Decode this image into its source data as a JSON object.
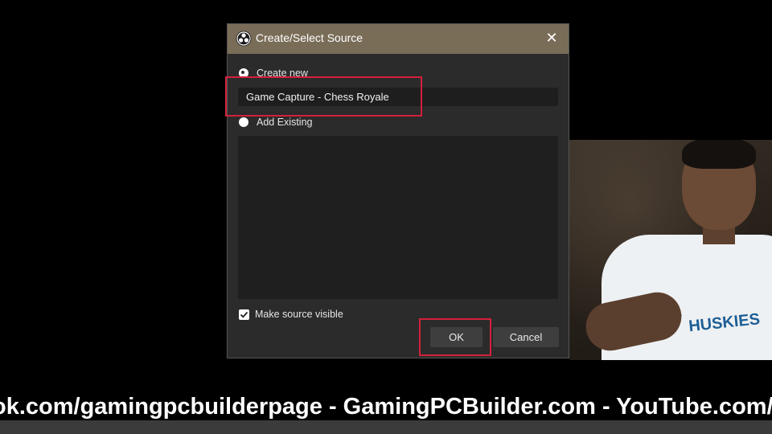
{
  "dialog": {
    "title": "Create/Select Source",
    "create_new_label": "Create new",
    "name_value": "Game Capture - Chess Royale",
    "add_existing_label": "Add Existing",
    "make_visible_label": "Make source visible",
    "make_visible_checked": true,
    "ok_label": "OK",
    "cancel_label": "Cancel"
  },
  "webcam": {
    "shirt_text": "HUSKIES"
  },
  "ticker": {
    "text": "ok.com/gamingpcbuilderpage - GamingPCBuilder.com - YouTube.com/c/ga"
  },
  "colors": {
    "titlebar": "#7a6d58",
    "highlight": "#d3203a",
    "dialog_bg": "#2b2b2b"
  },
  "icons": {
    "app": "obs-logo-icon",
    "close": "close-icon",
    "check": "checkmark-icon"
  }
}
